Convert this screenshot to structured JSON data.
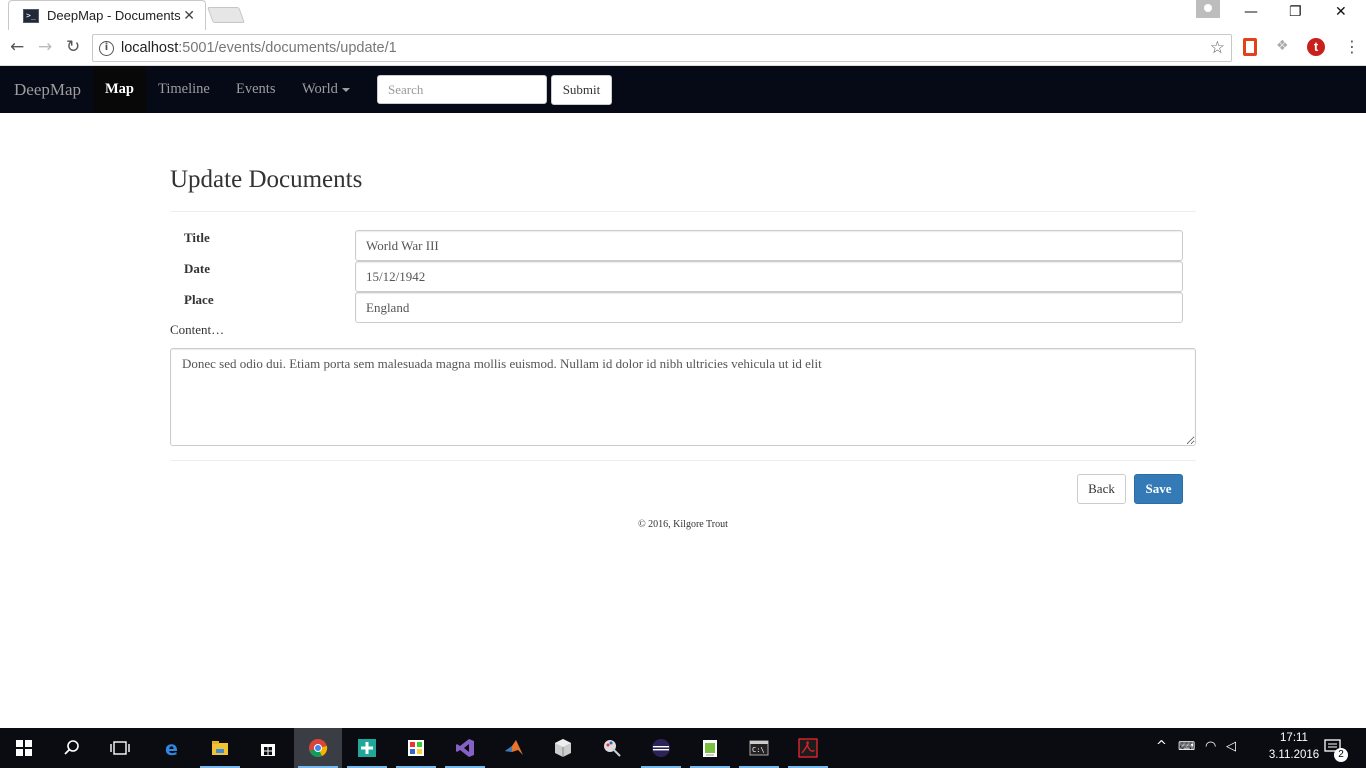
{
  "browser": {
    "tab_title": "DeepMap - Documents",
    "tab_close": "✕",
    "url_host": "localhost",
    "url_path": ":5001/events/documents/update/1",
    "ext_t_label": "t"
  },
  "navbar": {
    "brand": "DeepMap",
    "items": [
      {
        "label": "Map",
        "active": true
      },
      {
        "label": "Timeline"
      },
      {
        "label": "Events"
      },
      {
        "label": "World",
        "dropdown": true
      }
    ],
    "search_placeholder": "Search",
    "submit_label": "Submit"
  },
  "form": {
    "heading": "Update Documents",
    "fields": [
      {
        "label": "Title",
        "value": "World War III"
      },
      {
        "label": "Date",
        "value": "15/12/1942"
      },
      {
        "label": "Place",
        "value": "England"
      }
    ],
    "content_label": "Content…",
    "content_value": "Donec sed odio dui. Etiam porta sem malesuada magna mollis euismod. Nullam id dolor id nibh ultricies vehicula ut id elit",
    "back_label": "Back",
    "save_label": "Save"
  },
  "footer": {
    "text": "© 2016, Kilgore Trout"
  },
  "taskbar": {
    "time": "17:11",
    "date": "3.11.2016",
    "notification_count": "2"
  },
  "colors": {
    "navbar_bg": "#050a16",
    "primary": "#337ab7"
  }
}
